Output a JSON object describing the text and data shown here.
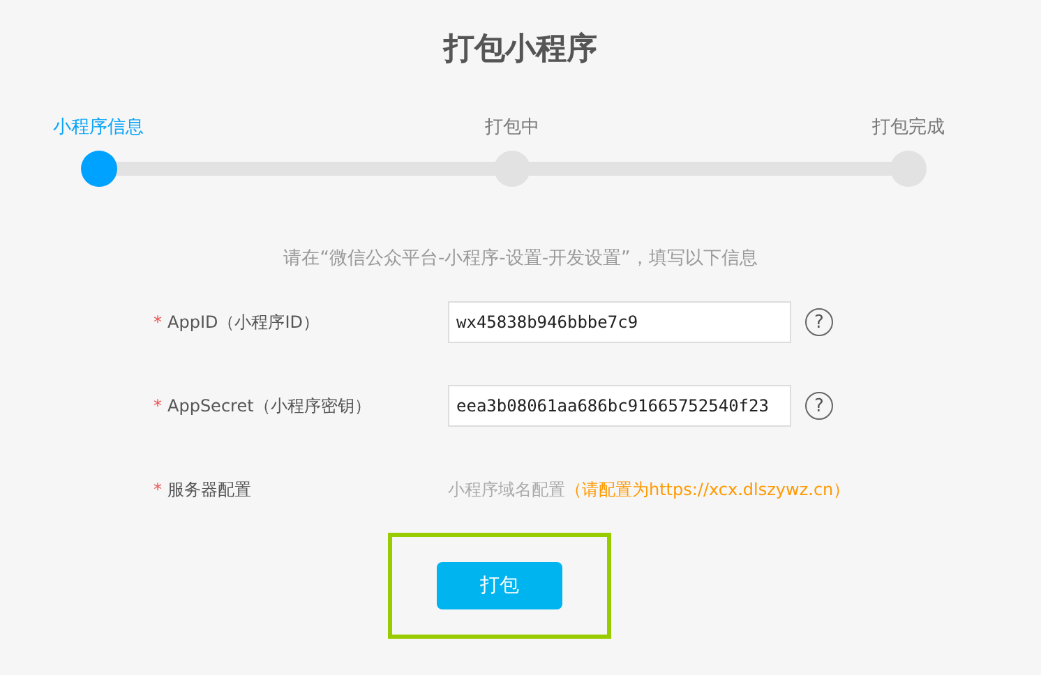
{
  "title": "打包小程序",
  "steps": [
    {
      "label": "小程序信息",
      "selected": true
    },
    {
      "label": "打包中",
      "selected": false
    },
    {
      "label": "打包完成",
      "selected": false
    }
  ],
  "instruction": "请在“微信公众平台-小程序-设置-开发设置”，填写以下信息",
  "fields": [
    {
      "kind": "input",
      "marker": "*",
      "label": "AppID（小程序ID）",
      "value": "wx45838b946bbbe7c9",
      "help": "?"
    },
    {
      "kind": "input",
      "marker": "*",
      "label": "AppSecret（小程序密钥）",
      "value": "eea3b08061aa686bc91665752540f23",
      "help": "?"
    },
    {
      "kind": "note",
      "marker": "*",
      "label": "服务器配置",
      "hint": "小程序域名配置",
      "note": "（请配置为https://xcx.dlszywz.cn）"
    }
  ],
  "submit": {
    "label": "打包",
    "highlighted": true
  }
}
